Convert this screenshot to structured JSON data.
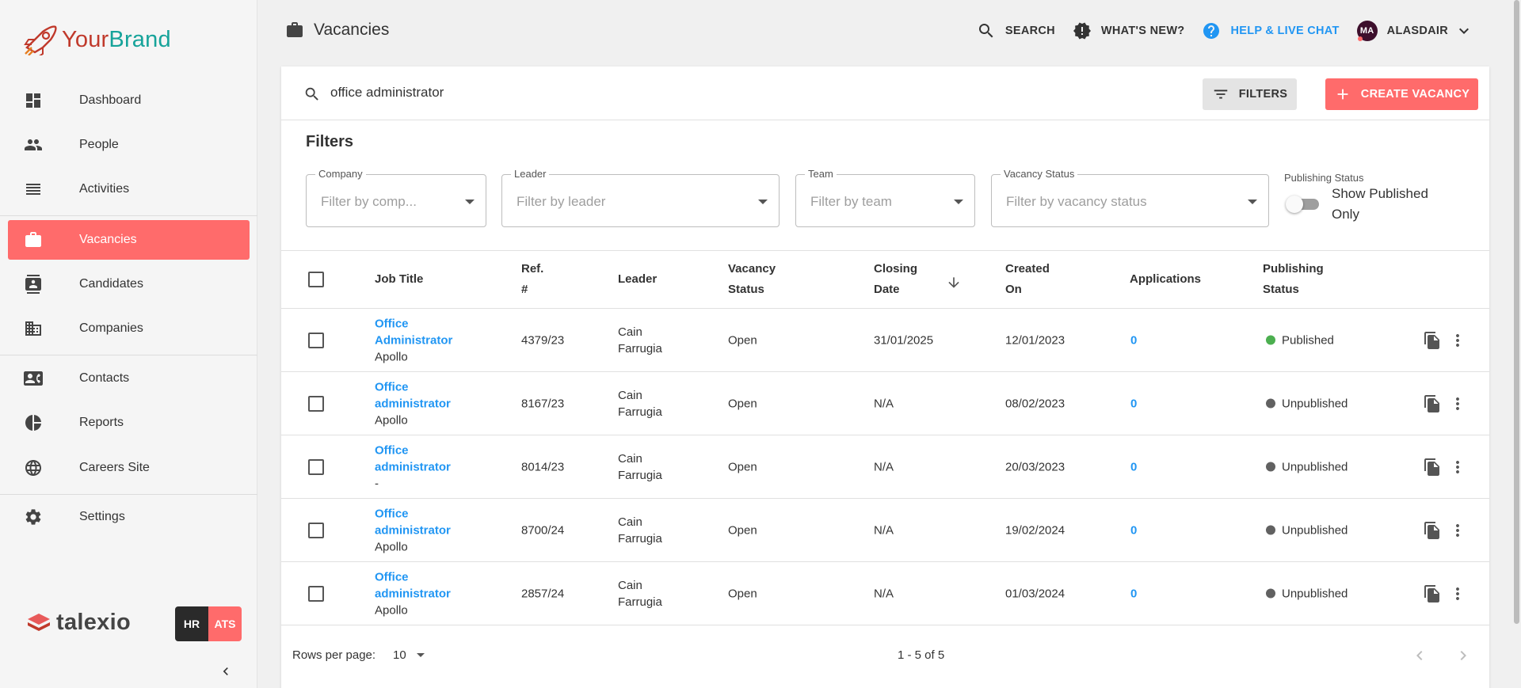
{
  "brand": {
    "part1": "Your",
    "part2": "Brand"
  },
  "sidebar": {
    "items": [
      {
        "label": "Dashboard",
        "icon": "dashboard-icon"
      },
      {
        "label": "People",
        "icon": "people-icon"
      },
      {
        "label": "Activities",
        "icon": "activities-icon"
      },
      {
        "label": "Vacancies",
        "icon": "briefcase-icon",
        "active": true
      },
      {
        "label": "Candidates",
        "icon": "candidate-icon"
      },
      {
        "label": "Companies",
        "icon": "companies-icon"
      },
      {
        "label": "Contacts",
        "icon": "contacts-icon"
      },
      {
        "label": "Reports",
        "icon": "reports-icon"
      },
      {
        "label": "Careers Site",
        "icon": "globe-icon"
      },
      {
        "label": "Settings",
        "icon": "gear-icon"
      }
    ],
    "footer_logo": "talexio",
    "badge_hr": "HR",
    "badge_ats": "ATS"
  },
  "header": {
    "title": "Vacancies",
    "search": "SEARCH",
    "whats_new": "WHAT'S NEW?",
    "help": "HELP & LIVE CHAT",
    "avatar_initials": "MA",
    "user": "ALASDAIR"
  },
  "toolbar": {
    "search_value": "office administrator",
    "filters_label": "FILTERS",
    "create_label": "CREATE VACANCY"
  },
  "filters": {
    "title": "Filters",
    "company": {
      "label": "Company",
      "placeholder": "Filter by comp..."
    },
    "leader": {
      "label": "Leader",
      "placeholder": "Filter by leader"
    },
    "team": {
      "label": "Team",
      "placeholder": "Filter by team"
    },
    "vacancy_status": {
      "label": "Vacancy Status",
      "placeholder": "Filter by vacancy status"
    },
    "publishing": {
      "label": "Publishing Status",
      "toggle_text": "Show Published Only",
      "checked": false
    }
  },
  "table": {
    "headers": {
      "job_title": "Job Title",
      "ref_1": "Ref.",
      "ref_2": "#",
      "leader": "Leader",
      "vacancy_1": "Vacancy",
      "vacancy_2": "Status",
      "closing_1": "Closing",
      "closing_2": "Date",
      "created_1": "Created",
      "created_2": "On",
      "applications": "Applications",
      "publishing_1": "Publishing",
      "publishing_2": "Status"
    },
    "rows": [
      {
        "title_1": "Office",
        "title_2": "Administrator",
        "company": "Apollo",
        "ref": "4379/23",
        "leader_1": "Cain",
        "leader_2": "Farrugia",
        "status": "Open",
        "closing": "31/01/2025",
        "created": "12/01/2023",
        "applications": "0",
        "publishing": "Published",
        "publishing_color": "#4caf50"
      },
      {
        "title_1": "Office",
        "title_2": "administrator",
        "company": "Apollo",
        "ref": "8167/23",
        "leader_1": "Cain",
        "leader_2": "Farrugia",
        "status": "Open",
        "closing": "N/A",
        "created": "08/02/2023",
        "applications": "0",
        "publishing": "Unpublished",
        "publishing_color": "#616161"
      },
      {
        "title_1": "Office",
        "title_2": "administrator",
        "company": "-",
        "ref": "8014/23",
        "leader_1": "Cain",
        "leader_2": "Farrugia",
        "status": "Open",
        "closing": "N/A",
        "created": "20/03/2023",
        "applications": "0",
        "publishing": "Unpublished",
        "publishing_color": "#616161"
      },
      {
        "title_1": "Office",
        "title_2": "administrator",
        "company": "Apollo",
        "ref": "8700/24",
        "leader_1": "Cain",
        "leader_2": "Farrugia",
        "status": "Open",
        "closing": "N/A",
        "created": "19/02/2024",
        "applications": "0",
        "publishing": "Unpublished",
        "publishing_color": "#616161"
      },
      {
        "title_1": "Office",
        "title_2": "administrator",
        "company": "Apollo",
        "ref": "2857/24",
        "leader_1": "Cain",
        "leader_2": "Farrugia",
        "status": "Open",
        "closing": "N/A",
        "created": "01/03/2024",
        "applications": "0",
        "publishing": "Unpublished",
        "publishing_color": "#616161"
      }
    ]
  },
  "pagination": {
    "rows_per_page_label": "Rows per page:",
    "rows_per_page": "10",
    "range": "1 - 5 of 5"
  },
  "colors": {
    "accent": "#ff6b6b",
    "link": "#2196f3",
    "brand_red": "#c0392b",
    "brand_teal": "#16a39a"
  }
}
